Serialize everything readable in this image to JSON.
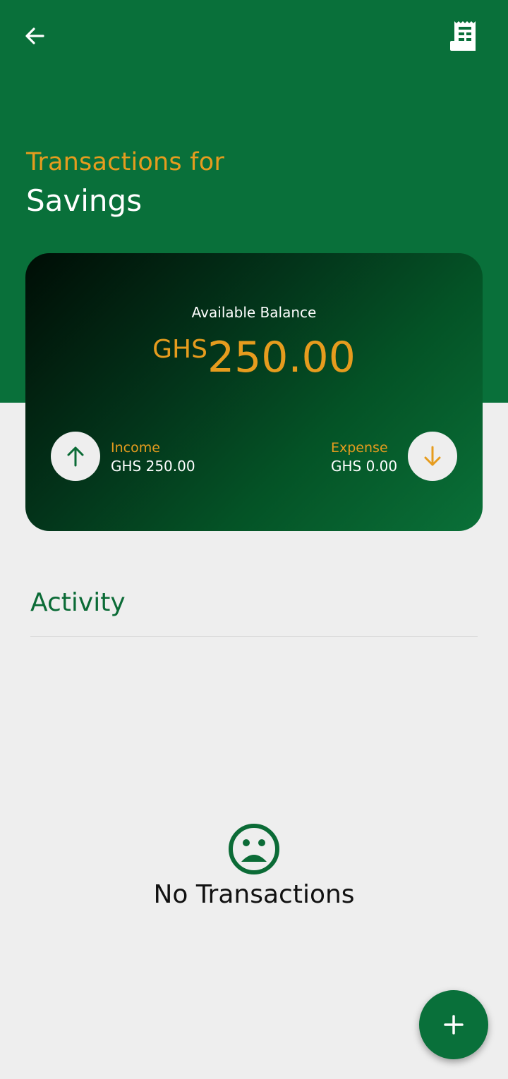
{
  "header": {
    "title_prefix": "Transactions for",
    "title": "Savings",
    "back_icon": "arrow-left-icon",
    "receipt_icon": "receipt-icon"
  },
  "card": {
    "available_label": "Available Balance",
    "currency": "GHS",
    "amount": "250.00",
    "income": {
      "label": "Income",
      "value": "GHS 250.00",
      "icon": "arrow-up-icon"
    },
    "expense": {
      "label": "Expense",
      "value": "GHS 0.00",
      "icon": "arrow-down-icon"
    }
  },
  "activity": {
    "title": "Activity",
    "empty_text": "No Transactions",
    "empty_icon": "sad-face-icon"
  },
  "fab": {
    "icon": "plus-icon"
  },
  "colors": {
    "primary_green": "#09703a",
    "accent_orange": "#e69c1e",
    "background": "#eeeeee"
  }
}
